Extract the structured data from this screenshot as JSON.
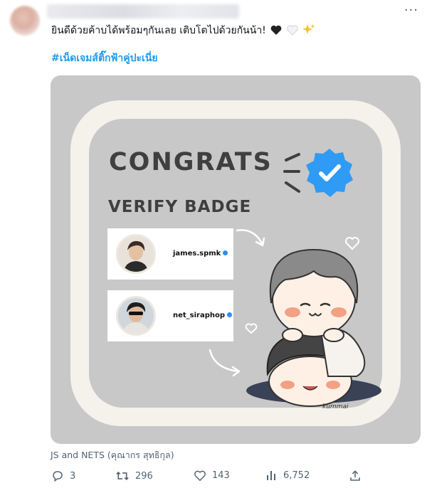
{
  "tweet": {
    "text": "ยินดีด้วยค้าบได้พร้อมๆกันเลย เติบโตไปด้วยกันน้า!",
    "hashtag": "#เน็ดเจมส์ติ๊กฟ้าคู่ปะเนี่ย",
    "caption": "JS and NETS (คุณากร สุทธิกุล)"
  },
  "image": {
    "title": "CONGRATS",
    "subtitle": "VERIFY BADGE",
    "accounts": [
      {
        "handle": "james.spmk"
      },
      {
        "handle": "net_siraphop"
      }
    ],
    "signature": "kummai"
  },
  "actions": {
    "replies": "3",
    "retweets": "296",
    "likes": "143",
    "views": "6,752"
  },
  "colors": {
    "accent": "#1d9bf0",
    "badge": "#2f9bf5",
    "text_secondary": "#536471",
    "card_bg": "#c8c8c8"
  },
  "icons": [
    "more-icon",
    "black-heart-icon",
    "white-heart-icon",
    "sparkles-icon",
    "verified-badge-icon",
    "reply-icon",
    "retweet-icon",
    "like-icon",
    "views-icon",
    "share-icon"
  ]
}
